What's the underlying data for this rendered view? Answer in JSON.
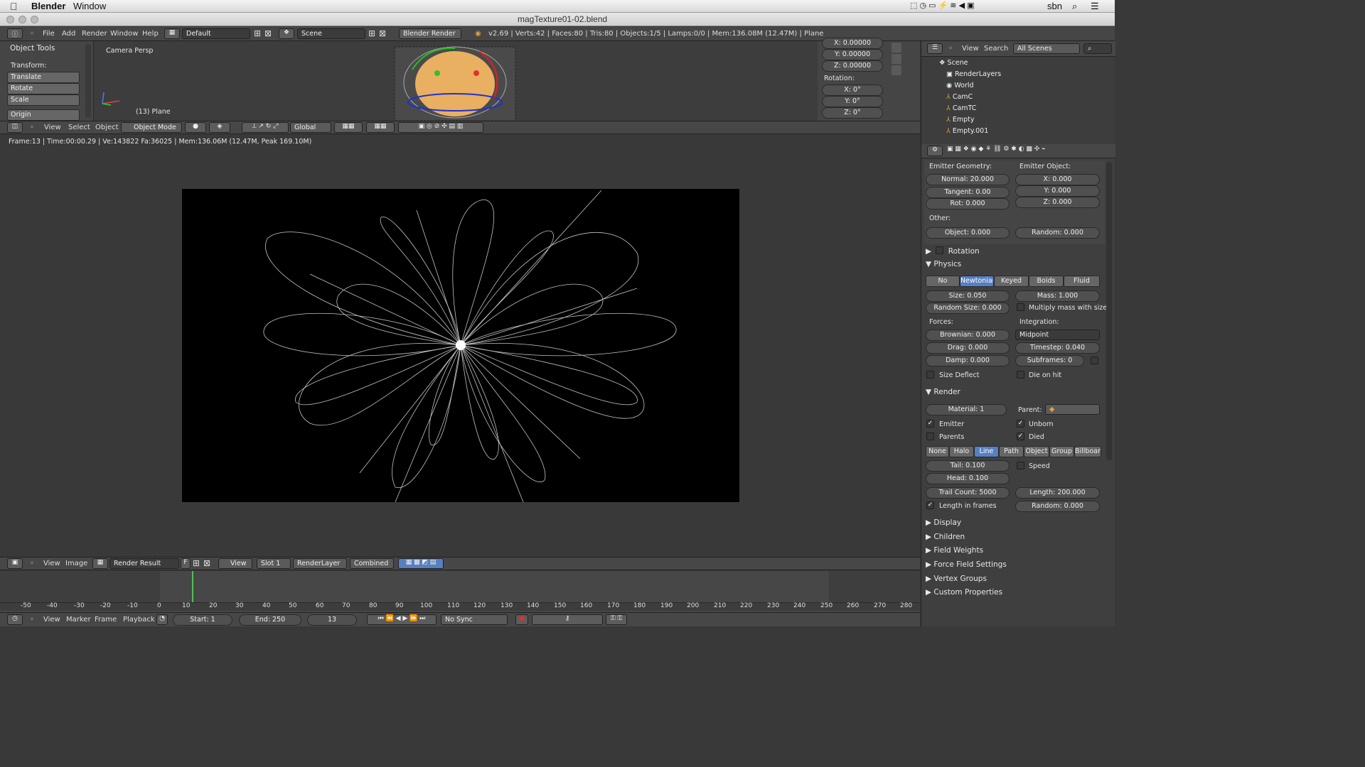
{
  "mac_menu": {
    "app": "Blender",
    "window": "Window",
    "user": "sbn"
  },
  "window_title": "magTexture01-02.blend",
  "infobar": {
    "menus": [
      "File",
      "Add",
      "Render",
      "Window",
      "Help"
    ],
    "layout": "Default",
    "scene": "Scene",
    "engine": "Blender Render",
    "stats": "v2.69 | Verts:42 | Faces:80 | Tris:80 | Objects:1/5 | Lamps:0/0 | Mem:136.08M (12.47M) | Plane"
  },
  "tool_shelf": {
    "title": "Object Tools",
    "transform_label": "Transform:",
    "buttons": [
      "Translate",
      "Rotate",
      "Scale"
    ],
    "origin": "Origin"
  },
  "viewport": {
    "view_name": "Camera Persp",
    "object_label": "(13) Plane",
    "header": {
      "menus": [
        "View",
        "Select",
        "Object"
      ],
      "mode": "Object Mode",
      "orientation": "Global"
    }
  },
  "npanel": {
    "loc": [
      "X: 0.00000",
      "Y: 0.00000",
      "Z: 0.00000"
    ],
    "rotation_label": "Rotation:",
    "rot": [
      "X: 0°",
      "Y: 0°",
      "Z: 0°"
    ]
  },
  "render_stats": "Frame:13 | Time:00:00.29 | Ve:143822 Fa:36025 | Mem:136.06M (12.47M, Peak 169.10M)",
  "image_header": {
    "menus": [
      "View",
      "Image"
    ],
    "image": "Render Result",
    "f": "F",
    "view": "View",
    "slot": "Slot 1",
    "layer": "RenderLayer",
    "pass": "Combined"
  },
  "timeline": {
    "ticks": [
      "-50",
      "-40",
      "-30",
      "-20",
      "-10",
      "0",
      "10",
      "20",
      "30",
      "40",
      "50",
      "60",
      "70",
      "80",
      "90",
      "100",
      "110",
      "120",
      "130",
      "140",
      "150",
      "160",
      "170",
      "180",
      "190",
      "200",
      "210",
      "220",
      "230",
      "240",
      "250",
      "260",
      "270",
      "280"
    ],
    "menus": [
      "View",
      "Marker",
      "Frame",
      "Playback"
    ],
    "start": "Start: 1",
    "end": "End: 250",
    "current": "13",
    "sync": "No Sync"
  },
  "outliner": {
    "menus": [
      "View",
      "Search"
    ],
    "filter": "All Scenes",
    "items": [
      "Scene",
      "RenderLayers",
      "World",
      "CamC",
      "CamTC",
      "Empty",
      "Empty.001"
    ]
  },
  "properties": {
    "emitter_geometry": "Emitter Geometry:",
    "emitter_object": "Emitter Object:",
    "normal": "Normal: 20.000",
    "tangent": "Tangent: 0.00",
    "rot": "Rot: 0.000",
    "ex": "X: 0.000",
    "ey": "Y: 0.000",
    "ez": "Z: 0.000",
    "other": "Other:",
    "object": "Object: 0.000",
    "random": "Random: 0.000",
    "rotation": "Rotation",
    "physics": "Physics",
    "physics_types": [
      "No",
      "Newtonian",
      "Keyed",
      "Boids",
      "Fluid"
    ],
    "size": "Size: 0.050",
    "mass": "Mass: 1.000",
    "random_size": "Random Size: 0.000",
    "mult_mass": "Multiply mass with size",
    "forces": "Forces:",
    "integration": "Integration:",
    "brownian": "Brownian: 0.000",
    "integrator": "Midpoint",
    "drag": "Drag: 0.000",
    "timestep": "Timestep: 0.040",
    "damp": "Damp: 0.000",
    "subframes": "Subframes: 0",
    "size_deflect": "Size Deflect",
    "die_on_hit": "Die on hit",
    "render": "Render",
    "material": "Material: 1",
    "parent": "Parent:",
    "emitter": "Emitter",
    "unborn": "Unborn",
    "parents": "Parents",
    "died": "Died",
    "render_types": [
      "None",
      "Halo",
      "Line",
      "Path",
      "Object",
      "Group",
      "Billboard"
    ],
    "tail": "Tail: 0.100",
    "speed": "Speed",
    "head": "Head: 0.100",
    "trail_count": "Trail Count: 5000",
    "length": "Length: 200.000",
    "length_in_frames": "Length in frames",
    "random2": "Random: 0.000",
    "collapsed": [
      "Display",
      "Children",
      "Field Weights",
      "Force Field Settings",
      "Vertex Groups",
      "Custom Properties"
    ]
  },
  "colors": {
    "selected": "#5680c2",
    "bg": "#393939",
    "panel": "#454545"
  }
}
